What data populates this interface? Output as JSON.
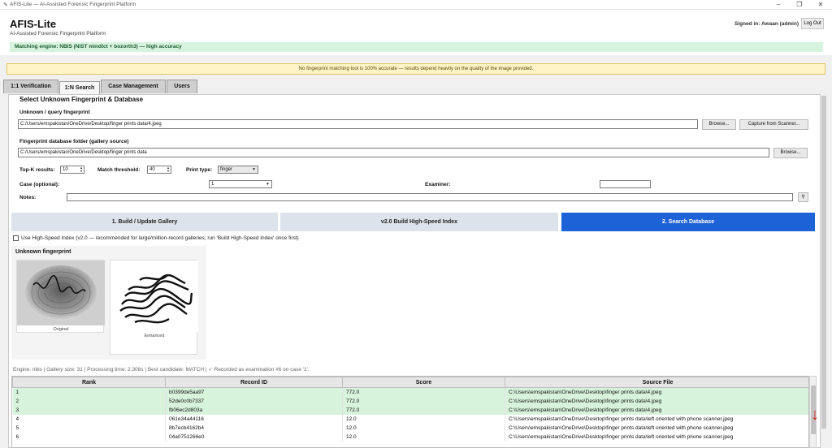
{
  "window": {
    "title": "AFIS-Lite — AI-Assisted Forensic Fingerprint Platform",
    "controls": [
      "–",
      "❐",
      "✕"
    ]
  },
  "header": {
    "app_title": "AFIS-Lite",
    "app_subtitle": "AI-Assisted Forensic Fingerprint Platform",
    "signed_in": "Signed in: Awaan (admin)",
    "logout_label": "Log Out",
    "engine": "Matching engine: NBIS (NIST mindtct + bozorth3) — high accuracy"
  },
  "warning": "No fingerprint matching tool is 100% accurate — results depend heavily on the quality of the image provided.",
  "tabs": [
    {
      "label": "1:1 Verification"
    },
    {
      "label": "1:N Search"
    },
    {
      "label": "Case Management"
    },
    {
      "label": "Users"
    }
  ],
  "active_tab": "1:N Search",
  "search": {
    "section_title": "Select Unknown Fingerprint & Database",
    "query_label": "Unknown / query fingerprint",
    "query_path": "C:/Users/emspakistan/OneDrive/Desktop/finger prints data/4.jpeg",
    "browse_label": "Browse...",
    "capture_label": "Capture from Scanner...",
    "gallery_label": "Fingerprint database folder (gallery source)",
    "gallery_path": "C:/Users/emspakistan/OneDrive/Desktop/finger prints data",
    "browse2_label": "Browse...",
    "topk_label": "Top-K results:",
    "topk_value": "10",
    "threshold_label": "Match threshold:",
    "threshold_value": "40",
    "print_type_label": "Print type:",
    "print_type_value": "finger",
    "case_label": "Case (optional):",
    "case_value": "1",
    "examiner_label": "Examiner:",
    "examiner_value": "",
    "notes_label": "Notes:",
    "notes_value": "",
    "notes_btn": "⚲"
  },
  "actions": {
    "build_gallery": "1. Build / Update Gallery",
    "build_index": "v2.0 Build High-Speed Index",
    "search_db": "2. Search Database"
  },
  "high_speed": {
    "checked": false,
    "label": "Use High-Speed Index (v2.0 — recommended for large/million-record galleries; run 'Build High-Speed Index' once first)"
  },
  "preview": {
    "title": "Unknown fingerprint",
    "original_caption": "Original",
    "enhanced_caption": "Enhanced"
  },
  "status_line": "Engine: nbis  |  Gallery size: 31  |  Processing time: 2.308s  |  Best candidate: MATCH  |  ✓ Recorded as examination #6 on case '1'.",
  "results": {
    "columns": [
      "Rank",
      "Record ID",
      "Score",
      "Source File"
    ],
    "rows": [
      {
        "rank": "1",
        "record_id": "b0399de5aa97",
        "score": "772.0",
        "source": "C:\\Users\\emspakistan\\OneDrive\\Desktop\\finger prints data\\4.jpeg",
        "match": true
      },
      {
        "rank": "2",
        "record_id": "52de0c0b7337",
        "score": "772.0",
        "source": "C:\\Users\\emspakistan\\OneDrive\\Desktop\\finger prints data\\4.jpeg",
        "match": true
      },
      {
        "rank": "3",
        "record_id": "fb06ec2d803a",
        "score": "772.0",
        "source": "C:\\Users\\emspakistan\\OneDrive\\Desktop\\finger prints data\\4.jpeg",
        "match": true
      },
      {
        "rank": "4",
        "record_id": "061e34a44116",
        "score": "12.0",
        "source": "C:\\Users\\emspakistan\\OneDrive\\Desktop\\finger prints data\\left oriented with phone scanner.jpeg",
        "match": false
      },
      {
        "rank": "5",
        "record_id": "8b7ecb4162b4",
        "score": "12.0",
        "source": "C:\\Users\\emspakistan\\OneDrive\\Desktop\\finger prints data\\left oriented with phone scanner.jpeg",
        "match": false
      },
      {
        "rank": "6",
        "record_id": "04a0751266e0",
        "score": "12.0",
        "source": "C:\\Users\\emspakistan\\OneDrive\\Desktop\\finger prints data\\left oriented with phone scanner.jpeg",
        "match": false
      }
    ]
  },
  "colors": {
    "accent": "#1e62d8",
    "match_row": "#d7f3dc",
    "engine_bg": "#d6f3dd",
    "warning_bg": "#fff4c8",
    "annotation_arrow": "#d92020"
  },
  "icons": [
    "pen-icon",
    "search-icon",
    "down-arrow-annotation-icon",
    "chevron-down-icon"
  ]
}
